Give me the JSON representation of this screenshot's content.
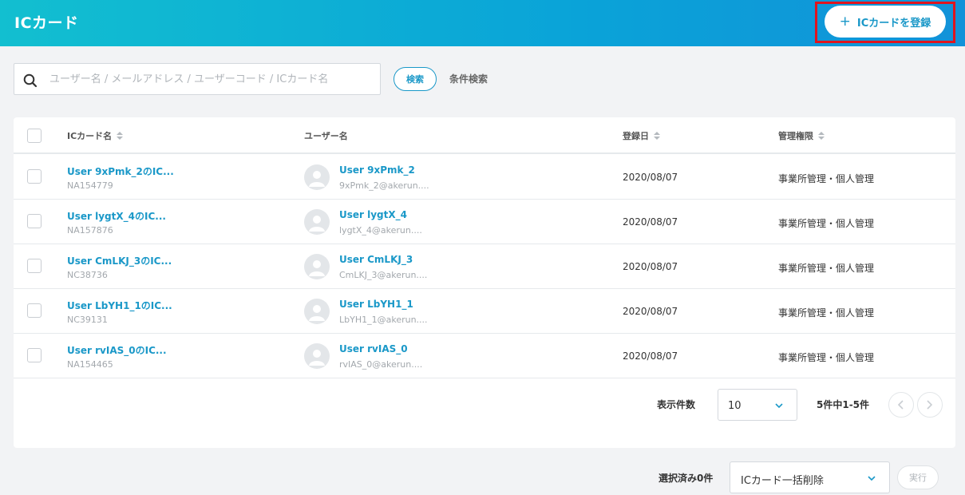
{
  "header": {
    "title": "ICカード",
    "register_button_icon": "plus-icon",
    "register_button_label": "ICカードを登録"
  },
  "search": {
    "placeholder": "ユーザー名 / メールアドレス / ユーザーコード / ICカード名",
    "value": "",
    "button_label": "検索",
    "advanced_label": "条件検索"
  },
  "table": {
    "columns": {
      "card_name": "ICカード名",
      "user_name": "ユーザー名",
      "registered": "登録日",
      "permission": "管理権限"
    },
    "rows": [
      {
        "card_name": "User 9xPmk_2のIC...",
        "card_code": "NA154779",
        "user_name": "User 9xPmk_2",
        "user_email": "9xPmk_2@akerun....",
        "date": "2020/08/07",
        "permission": "事業所管理・個人管理"
      },
      {
        "card_name": "User lygtX_4のIC...",
        "card_code": "NA157876",
        "user_name": "User lygtX_4",
        "user_email": "lygtX_4@akerun....",
        "date": "2020/08/07",
        "permission": "事業所管理・個人管理"
      },
      {
        "card_name": "User CmLKJ_3のIC...",
        "card_code": "NC38736",
        "user_name": "User CmLKJ_3",
        "user_email": "CmLKJ_3@akerun....",
        "date": "2020/08/07",
        "permission": "事業所管理・個人管理"
      },
      {
        "card_name": "User LbYH1_1のIC...",
        "card_code": "NC39131",
        "user_name": "User LbYH1_1",
        "user_email": "LbYH1_1@akerun....",
        "date": "2020/08/07",
        "permission": "事業所管理・個人管理"
      },
      {
        "card_name": "User rvIAS_0のIC...",
        "card_code": "NA154465",
        "user_name": "User rvIAS_0",
        "user_email": "rvIAS_0@akerun....",
        "date": "2020/08/07",
        "permission": "事業所管理・個人管理"
      }
    ]
  },
  "pagination": {
    "per_page_label": "表示件数",
    "per_page_value": "10",
    "info": "5件中1-5件"
  },
  "bulk": {
    "selected_label": "選択済み0件",
    "action_value": "ICカード一括削除",
    "execute_label": "実行"
  },
  "colors": {
    "header_gradient_start": "#12bfd0",
    "header_gradient_end": "#1292d9",
    "accent": "#1a98c8",
    "highlight_outline": "#e0141e"
  }
}
